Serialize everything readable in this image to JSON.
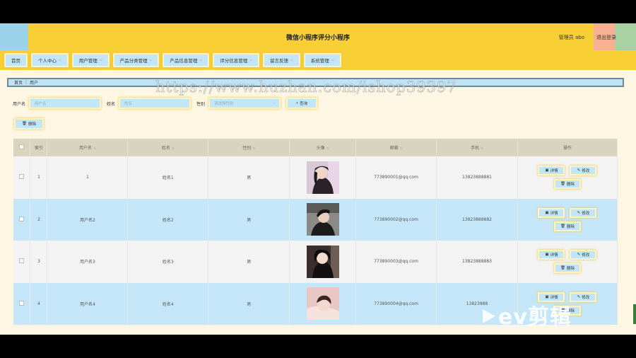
{
  "header": {
    "title": "微信小程序评分小程序",
    "user": "管理员 abo",
    "logout": "退出登录"
  },
  "nav": [
    {
      "label": "首页",
      "dropdown": false
    },
    {
      "label": "个人中心",
      "dropdown": true
    },
    {
      "label": "用户管理",
      "dropdown": true
    },
    {
      "label": "产品分类管理",
      "dropdown": true
    },
    {
      "label": "产品信息管理",
      "dropdown": true
    },
    {
      "label": "评分信息管理",
      "dropdown": true
    },
    {
      "label": "留言反馈",
      "dropdown": true
    },
    {
      "label": "系统管理",
      "dropdown": true
    }
  ],
  "breadcrumb": {
    "home": "首页",
    "current": "用户"
  },
  "watermark": "https://www.huzhan.com/ishop39397",
  "search": {
    "username_label": "用户名",
    "username_placeholder": "用户名",
    "name_label": "姓名",
    "name_placeholder": "姓名",
    "gender_label": "性别",
    "gender_placeholder": "请选择性别",
    "query_button": "查询",
    "delete_button": "删除"
  },
  "table": {
    "headers": [
      "索引",
      "用户名",
      "姓名",
      "性别",
      "头像",
      "邮箱",
      "手机",
      "操作"
    ],
    "rows": [
      {
        "index": "1",
        "username": "1",
        "name": "姓名1",
        "gender": "男",
        "email": "773890001@qq.com",
        "phone": "13823888881"
      },
      {
        "index": "2",
        "username": "用户名2",
        "name": "姓名2",
        "gender": "男",
        "email": "773890002@qq.com",
        "phone": "13823888882"
      },
      {
        "index": "3",
        "username": "用户名3",
        "name": "姓名3",
        "gender": "男",
        "email": "773890003@qq.com",
        "phone": "13823888883"
      },
      {
        "index": "4",
        "username": "用户名4",
        "name": "姓名4",
        "gender": "男",
        "email": "773890004@qq.com",
        "phone": "13823888"
      }
    ],
    "actions": {
      "detail": "详情",
      "edit": "修改",
      "delete": "删除"
    }
  },
  "overlay_logo": "ev剪辑"
}
